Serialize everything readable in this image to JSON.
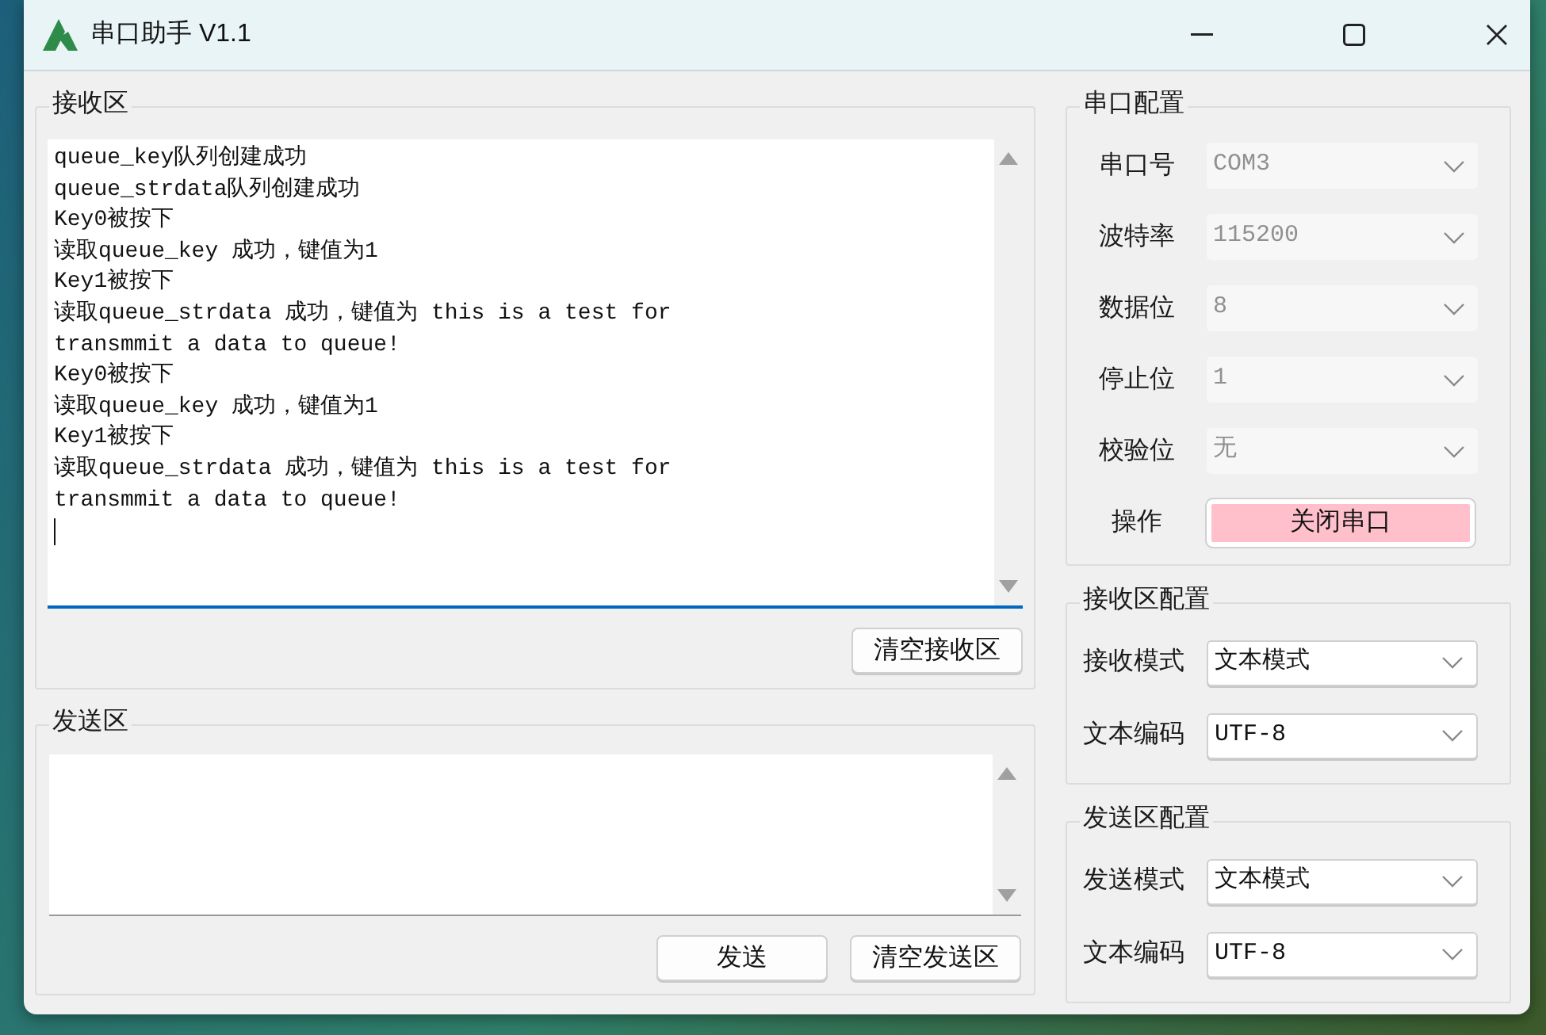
{
  "window": {
    "title": "串口助手 V1.1"
  },
  "receive": {
    "title": "接收区",
    "lines": [
      "queue_key队列创建成功",
      "queue_strdata队列创建成功",
      "Key0被按下",
      "读取queue_key 成功，键值为1",
      "Key1被按下",
      "读取queue_strdata 成功，键值为 this is a test for",
      "transmmit a data to queue!",
      "Key0被按下",
      "读取queue_key 成功，键值为1",
      "Key1被按下",
      "读取queue_strdata 成功，键值为 this is a test for",
      "transmmit a data to queue!"
    ],
    "focused": true,
    "buttons": [
      "清空接收区"
    ]
  },
  "send": {
    "title": "发送区",
    "buttons": [
      "发送",
      "清空发送区"
    ]
  },
  "config_groups": [
    {
      "title": "串口配置",
      "rows": [
        {
          "kind": "combo",
          "label": "串口号",
          "value": "COM3",
          "disabled": true
        },
        {
          "kind": "combo",
          "label": "波特率",
          "value": "115200",
          "disabled": true
        },
        {
          "kind": "combo",
          "label": "数据位",
          "value": "8",
          "disabled": true
        },
        {
          "kind": "combo",
          "label": "停止位",
          "value": "1",
          "disabled": true
        },
        {
          "kind": "combo",
          "label": "校验位",
          "value": "无",
          "disabled": true
        },
        {
          "kind": "button",
          "label": "操作",
          "value": "关闭串口"
        }
      ]
    },
    {
      "title": "接收区配置",
      "rows": [
        {
          "kind": "combo",
          "label": "接收模式",
          "value": "文本模式",
          "disabled": false
        },
        {
          "kind": "combo",
          "label": "文本编码",
          "value": "UTF-8",
          "disabled": false
        }
      ]
    },
    {
      "title": "发送区配置",
      "rows": [
        {
          "kind": "combo",
          "label": "发送模式",
          "value": "文本模式",
          "disabled": false
        },
        {
          "kind": "combo",
          "label": "文本编码",
          "value": "UTF-8",
          "disabled": false
        }
      ]
    }
  ]
}
